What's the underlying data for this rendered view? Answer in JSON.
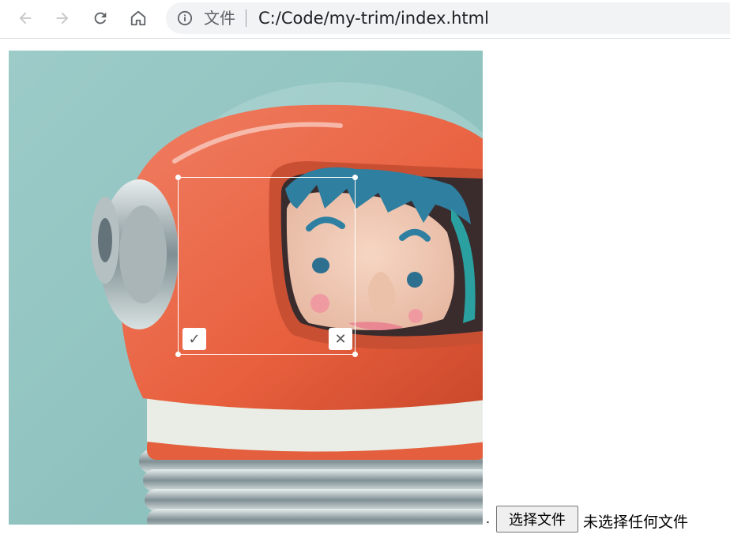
{
  "browser": {
    "back_icon": "arrow-left-icon",
    "forward_icon": "arrow-right-icon",
    "reload_icon": "reload-icon",
    "home_icon": "home-icon",
    "address": {
      "info_icon": "info-icon",
      "chip_label": "文件",
      "url": "C:/Code/my-trim/index.html"
    }
  },
  "cropper": {
    "confirm_label": "✓",
    "cancel_label": "✕",
    "border_color": "#ffffff"
  },
  "file_input": {
    "prefix": ".",
    "button_label": "选择文件",
    "status_text": "未选择任何文件"
  }
}
